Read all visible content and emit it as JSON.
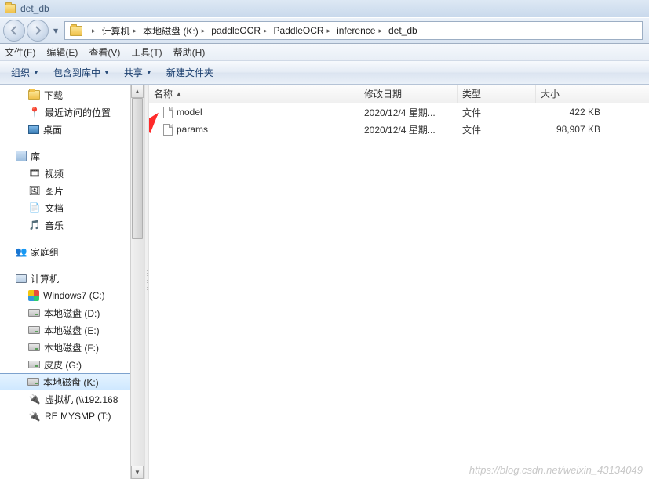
{
  "title": "det_db",
  "breadcrumb": [
    "计算机",
    "本地磁盘 (K:)",
    "paddleOCR",
    "PaddleOCR",
    "inference",
    "det_db"
  ],
  "menu": {
    "file": "文件(F)",
    "edit": "编辑(E)",
    "view": "查看(V)",
    "tools": "工具(T)",
    "help": "帮助(H)"
  },
  "toolbar": {
    "organize": "组织",
    "include": "包含到库中",
    "share": "共享",
    "newfolder": "新建文件夹"
  },
  "columns": {
    "name": "名称",
    "date": "修改日期",
    "type": "类型",
    "size": "大小"
  },
  "sidebar": {
    "quick": {
      "downloads": "下载",
      "recent": "最近访问的位置",
      "desktop": "桌面"
    },
    "lib": {
      "title": "库",
      "video": "视频",
      "pictures": "图片",
      "docs": "文档",
      "music": "音乐"
    },
    "homegroup": "家庭组",
    "computer": {
      "title": "计算机",
      "win7": "Windows7 (C:)",
      "d": "本地磁盘 (D:)",
      "e": "本地磁盘 (E:)",
      "f": "本地磁盘 (F:)",
      "g": "皮皮 (G:)",
      "k": "本地磁盘 (K:)",
      "vm": "虚拟机 (\\\\192.168",
      "re": "RE MYSMP (T:)"
    }
  },
  "files": [
    {
      "name": "model",
      "date": "2020/12/4 星期...",
      "type": "文件",
      "size": "422 KB"
    },
    {
      "name": "params",
      "date": "2020/12/4 星期...",
      "type": "文件",
      "size": "98,907 KB"
    }
  ],
  "watermark": "https://blog.csdn.net/weixin_43134049"
}
